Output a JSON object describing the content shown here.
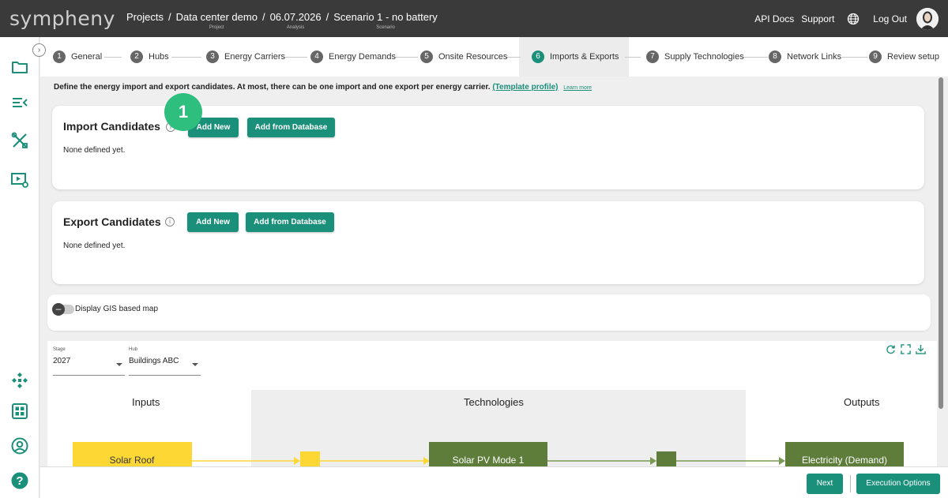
{
  "app": {
    "logo": "sympheny"
  },
  "breadcrumbs": [
    {
      "label": "Projects",
      "sub": ""
    },
    {
      "label": "Data center demo",
      "sub": "Project"
    },
    {
      "label": "06.07.2026",
      "sub": "Analysis"
    },
    {
      "label": "Scenario 1 - no battery",
      "sub": "Scenario"
    }
  ],
  "breadcrumb_separator": "/",
  "topnav": {
    "api_docs": "API Docs",
    "support": "Support",
    "logout": "Log Out"
  },
  "sidebar": {
    "top_icons": [
      "folder-icon",
      "list-collapse-icon",
      "tools-icon",
      "play-settings-icon"
    ],
    "bottom_icons": [
      "network-icon",
      "dashboard-icon",
      "user-circle-icon",
      "help-icon"
    ]
  },
  "stepper": {
    "steps": [
      {
        "num": "1",
        "label": "General"
      },
      {
        "num": "2",
        "label": "Hubs"
      },
      {
        "num": "3",
        "label": "Energy Carriers"
      },
      {
        "num": "4",
        "label": "Energy Demands"
      },
      {
        "num": "5",
        "label": "Onsite Resources"
      },
      {
        "num": "6",
        "label": "Imports & Exports"
      },
      {
        "num": "7",
        "label": "Supply Technologies"
      },
      {
        "num": "8",
        "label": "Network Links"
      },
      {
        "num": "9",
        "label": "Review setup"
      }
    ],
    "active_index": 5
  },
  "intro": {
    "text": "Define the energy import and export candidates. At most, there can be one import and one export per energy carrier.",
    "template_link": "(Template profile)",
    "learn_more": "Learn more"
  },
  "badge": "1",
  "import": {
    "title": "Import Candidates",
    "add_new": "Add New",
    "add_db": "Add from Database",
    "empty": "None defined yet."
  },
  "export": {
    "title": "Export Candidates",
    "add_new": "Add New",
    "add_db": "Add from Database",
    "empty": "None defined yet."
  },
  "gis": {
    "label": "Display GIS based map",
    "enabled": false
  },
  "diagram": {
    "stage": {
      "label": "Stage",
      "value": "2027"
    },
    "hub": {
      "label": "Hub",
      "value": "Buildings ABC"
    },
    "columns": {
      "inputs": "Inputs",
      "technologies": "Technologies",
      "outputs": "Outputs"
    },
    "nodes": {
      "input": "Solar Roof",
      "tech": "Solar PV Mode 1",
      "output": "Electricity (Demand)"
    },
    "colors": {
      "input": "#fdd835",
      "tech": "#5e7c3a",
      "output": "#5e7c3a",
      "tech_bg": "#eeeeee"
    }
  },
  "footer": {
    "next": "Next",
    "execution_options": "Execution Options"
  },
  "colors": {
    "accent": "#1a8f7a",
    "badge": "#2ebf7e",
    "topbar": "#3a3a3a"
  }
}
